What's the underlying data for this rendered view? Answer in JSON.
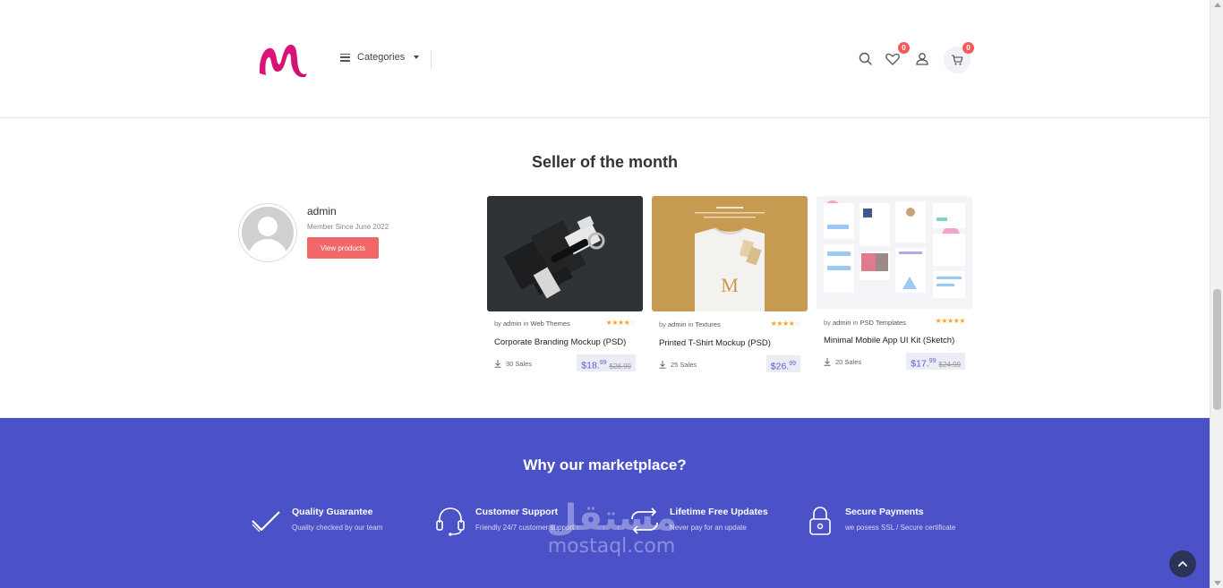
{
  "header": {
    "categories_label": "Categories",
    "wishlist_count": "0",
    "cart_count": "0",
    "brand_color": "#e91e8c"
  },
  "seller": {
    "section_title": "Seller of the month",
    "name": "admin",
    "member_since": "Member Since June 2022",
    "view_products_label": "View products"
  },
  "products": [
    {
      "by_prefix": "by",
      "author": "admin",
      "in_prefix": "in",
      "category": "Web Themes",
      "rating": 4,
      "title": "Corporate Branding Mockup (PSD)",
      "sales": "30 Sales",
      "price_main": "$18.",
      "price_cents": "99",
      "old_price": "$28.99"
    },
    {
      "by_prefix": "by",
      "author": "admin",
      "in_prefix": "in",
      "category": "Textures",
      "rating": 4,
      "title": "Printed T-Shirt Mockup (PSD)",
      "sales": "25 Sales",
      "price_main": "$26.",
      "price_cents": "99",
      "old_price": ""
    },
    {
      "by_prefix": "by",
      "author": "admin",
      "in_prefix": "in",
      "category": "PSD Templates",
      "rating": 5,
      "title": "Minimal Mobile App UI Kit (Sketch)",
      "sales": "20 Sales",
      "price_main": "$17.",
      "price_cents": "99",
      "old_price": "$24.99"
    }
  ],
  "why": {
    "title": "Why our marketplace?",
    "features": [
      {
        "icon": "check-icon",
        "title": "Quality Guarantee",
        "subtitle": "Quality checked by our team"
      },
      {
        "icon": "headset-icon",
        "title": "Customer Support",
        "subtitle": "Friendly 24/7 customer support"
      },
      {
        "icon": "refresh-icon",
        "title": "Lifetime Free Updates",
        "subtitle": "Never pay for an update"
      },
      {
        "icon": "lock-icon",
        "title": "Secure Payments",
        "subtitle": "we posess SSL / Secure certificate"
      }
    ],
    "bg_color": "#4b52c8"
  },
  "watermark": {
    "arabic": "مستقل",
    "latin": "mostaql.com"
  }
}
